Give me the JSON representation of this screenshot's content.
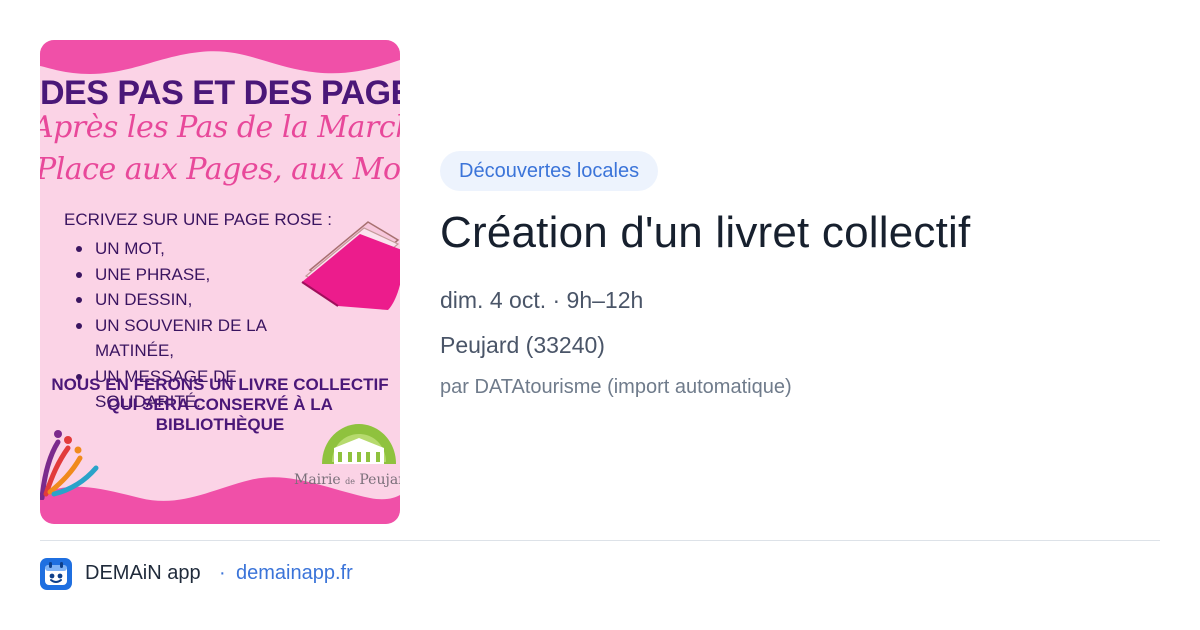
{
  "poster": {
    "title": "DES PAS ET DES PAGES",
    "script_line_1": "Après les Pas de la Marche",
    "script_line_2": "Place aux Pages, aux Mots...",
    "list_heading": "ECRIVEZ SUR UNE PAGE ROSE :",
    "list_items": [
      "UN MOT,",
      "UNE PHRASE,",
      "UN DESSIN,",
      "UN SOUVENIR DE LA MATINÉE,",
      "UN MESSAGE DE SOLIDARITÉ."
    ],
    "bottom_line_1": "NOUS EN FERONS UN LIVRE COLLECTIF",
    "bottom_line_2": "QUI SERA CONSERVÉ À LA",
    "bottom_line_3": "BIBLIOTHÈQUE",
    "mairie_label": "Mairie",
    "mairie_de": "de",
    "mairie_town": "Peujard",
    "colors": {
      "background": "#fbd3e6",
      "band": "#f050a8",
      "title": "#4a1778",
      "script": "#e8489a"
    }
  },
  "event": {
    "category": "Découvertes locales",
    "title": "Création d'un livret collectif",
    "when": "dim. 4 oct. · 9h–12h",
    "where": "Peujard (33240)",
    "source": "par DATAtourisme (import automatique)"
  },
  "footer": {
    "app_icon": "demain-app-icon",
    "app_name": "DEMAiN app",
    "separator": "·",
    "link_text": "demainapp.fr"
  },
  "colors": {
    "accent": "#3b74d9",
    "category_bg": "#edf3fd",
    "title": "#17202e",
    "meta": "#4a5568",
    "muted": "#6f7b8b"
  }
}
